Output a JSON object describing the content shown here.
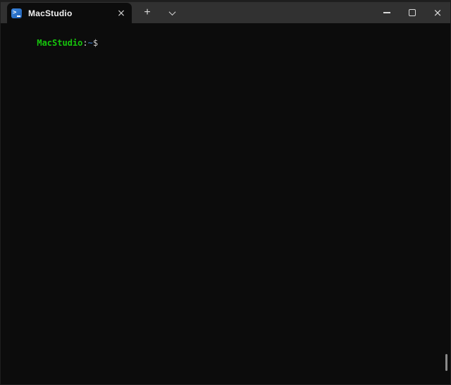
{
  "window": {
    "app": "Windows Terminal",
    "title": "MacStudio"
  },
  "titlebar": {
    "tab": {
      "title": "MacStudio",
      "icon": "powershell-icon",
      "close_glyph": "×"
    },
    "new_tab_glyph": "+",
    "controls": {
      "minimize": "minimize",
      "maximize": "maximize",
      "close_glyph": "×"
    }
  },
  "terminal": {
    "prompt_segments": [
      {
        "text": "MacStudio",
        "color": "prompt-green",
        "bold": true
      },
      {
        "text": ":",
        "color": "prompt-fg",
        "bold": false
      },
      {
        "text": "~",
        "color": "prompt-blue",
        "bold": true
      },
      {
        "text": "$",
        "color": "prompt-fg",
        "bold": false
      }
    ],
    "scrollbar": {
      "position": "bottom"
    }
  },
  "colors": {
    "titlebar-bg": "#313131",
    "terminal-bg": "#0c0c0c",
    "tab-title-fg": "#f0f0f0",
    "control-fg": "#d9d9d9",
    "prompt-green": "#16c60c",
    "prompt-blue": "#3465a4",
    "prompt-fg": "#cccccc",
    "scrollbar-thumb": "#8a8a8a",
    "icon-blue": "#2c72c7"
  }
}
